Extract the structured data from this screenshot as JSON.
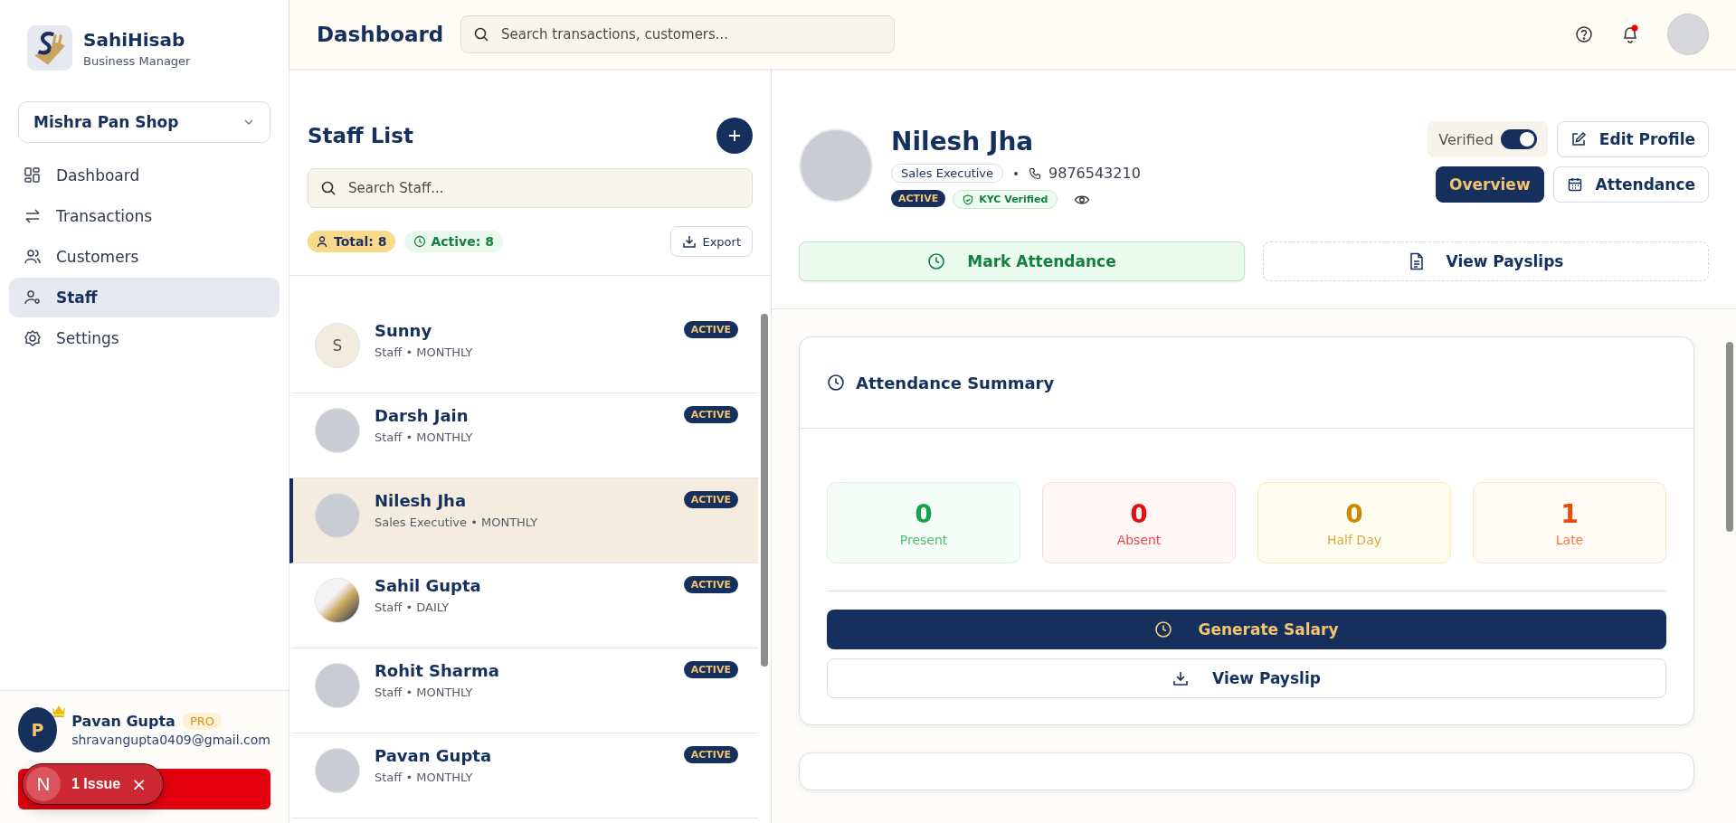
{
  "brand": {
    "name": "SahiHisab",
    "tagline": "Business Manager"
  },
  "shop_selector": {
    "value": "Mishra Pan Shop"
  },
  "sidebar": {
    "items": [
      {
        "label": "Dashboard",
        "selected": false
      },
      {
        "label": "Transactions",
        "selected": false
      },
      {
        "label": "Customers",
        "selected": false
      },
      {
        "label": "Staff",
        "selected": true
      },
      {
        "label": "Settings",
        "selected": false
      }
    ]
  },
  "user": {
    "initial": "P",
    "name": "Pavan Gupta",
    "badge": "PRO",
    "email": "shravangupta0409@gmail.com"
  },
  "issue_indicator": {
    "logo": "N",
    "label": "1 Issue",
    "close": "×"
  },
  "header": {
    "title": "Dashboard",
    "search": {
      "placeholder": "Search transactions, customers..."
    },
    "has_notification": true
  },
  "staff_list": {
    "title": "Staff List",
    "search": {
      "placeholder": "Search Staff..."
    },
    "total": "Total: 8",
    "active": "Active: 8",
    "export": "Export",
    "rows": [
      {
        "name": "Sunny",
        "subtitle": "Staff • MONTHLY",
        "status": "ACTIVE",
        "avatar": {
          "kind": "initial",
          "text": "S"
        },
        "selected": false
      },
      {
        "name": "Darsh Jain",
        "subtitle": "Staff • MONTHLY",
        "status": "ACTIVE",
        "avatar": {
          "kind": "photo"
        },
        "selected": false
      },
      {
        "name": "Nilesh Jha",
        "subtitle": "Sales Executive • MONTHLY",
        "status": "ACTIVE",
        "avatar": {
          "kind": "photo"
        },
        "selected": true
      },
      {
        "name": "Sahil Gupta",
        "subtitle": "Staff • DAILY",
        "status": "ACTIVE",
        "avatar": {
          "kind": "logo"
        },
        "selected": false
      },
      {
        "name": "Rohit Sharma",
        "subtitle": "Staff • MONTHLY",
        "status": "ACTIVE",
        "avatar": {
          "kind": "photo"
        },
        "selected": false
      },
      {
        "name": "Pavan Gupta",
        "subtitle": "Staff • MONTHLY",
        "status": "ACTIVE",
        "avatar": {
          "kind": "photo"
        },
        "selected": false
      }
    ]
  },
  "profile": {
    "name": "Nilesh Jha",
    "role": "Sales Executive",
    "phone": "9876543210",
    "status": "ACTIVE",
    "kyc": "KYC Verified",
    "verified_toggle": {
      "label": "Verified",
      "on": true
    },
    "edit": "Edit Profile",
    "tabs": [
      {
        "label": "Overview",
        "selected": true
      },
      {
        "label": "Attendance",
        "selected": false
      }
    ],
    "actions": [
      {
        "label": "Mark Attendance",
        "kind": "primary"
      },
      {
        "label": "View Payslips",
        "kind": "dashed"
      }
    ]
  },
  "attendance_summary": {
    "title": "Attendance Summary",
    "stats": [
      {
        "value": "0",
        "label": "Present",
        "kind": "present"
      },
      {
        "value": "0",
        "label": "Absent",
        "kind": "absent"
      },
      {
        "value": "0",
        "label": "Half Day",
        "kind": "half"
      },
      {
        "value": "1",
        "label": "Late",
        "kind": "late"
      }
    ],
    "generate": "Generate Salary",
    "payslip": "View Payslip"
  }
}
